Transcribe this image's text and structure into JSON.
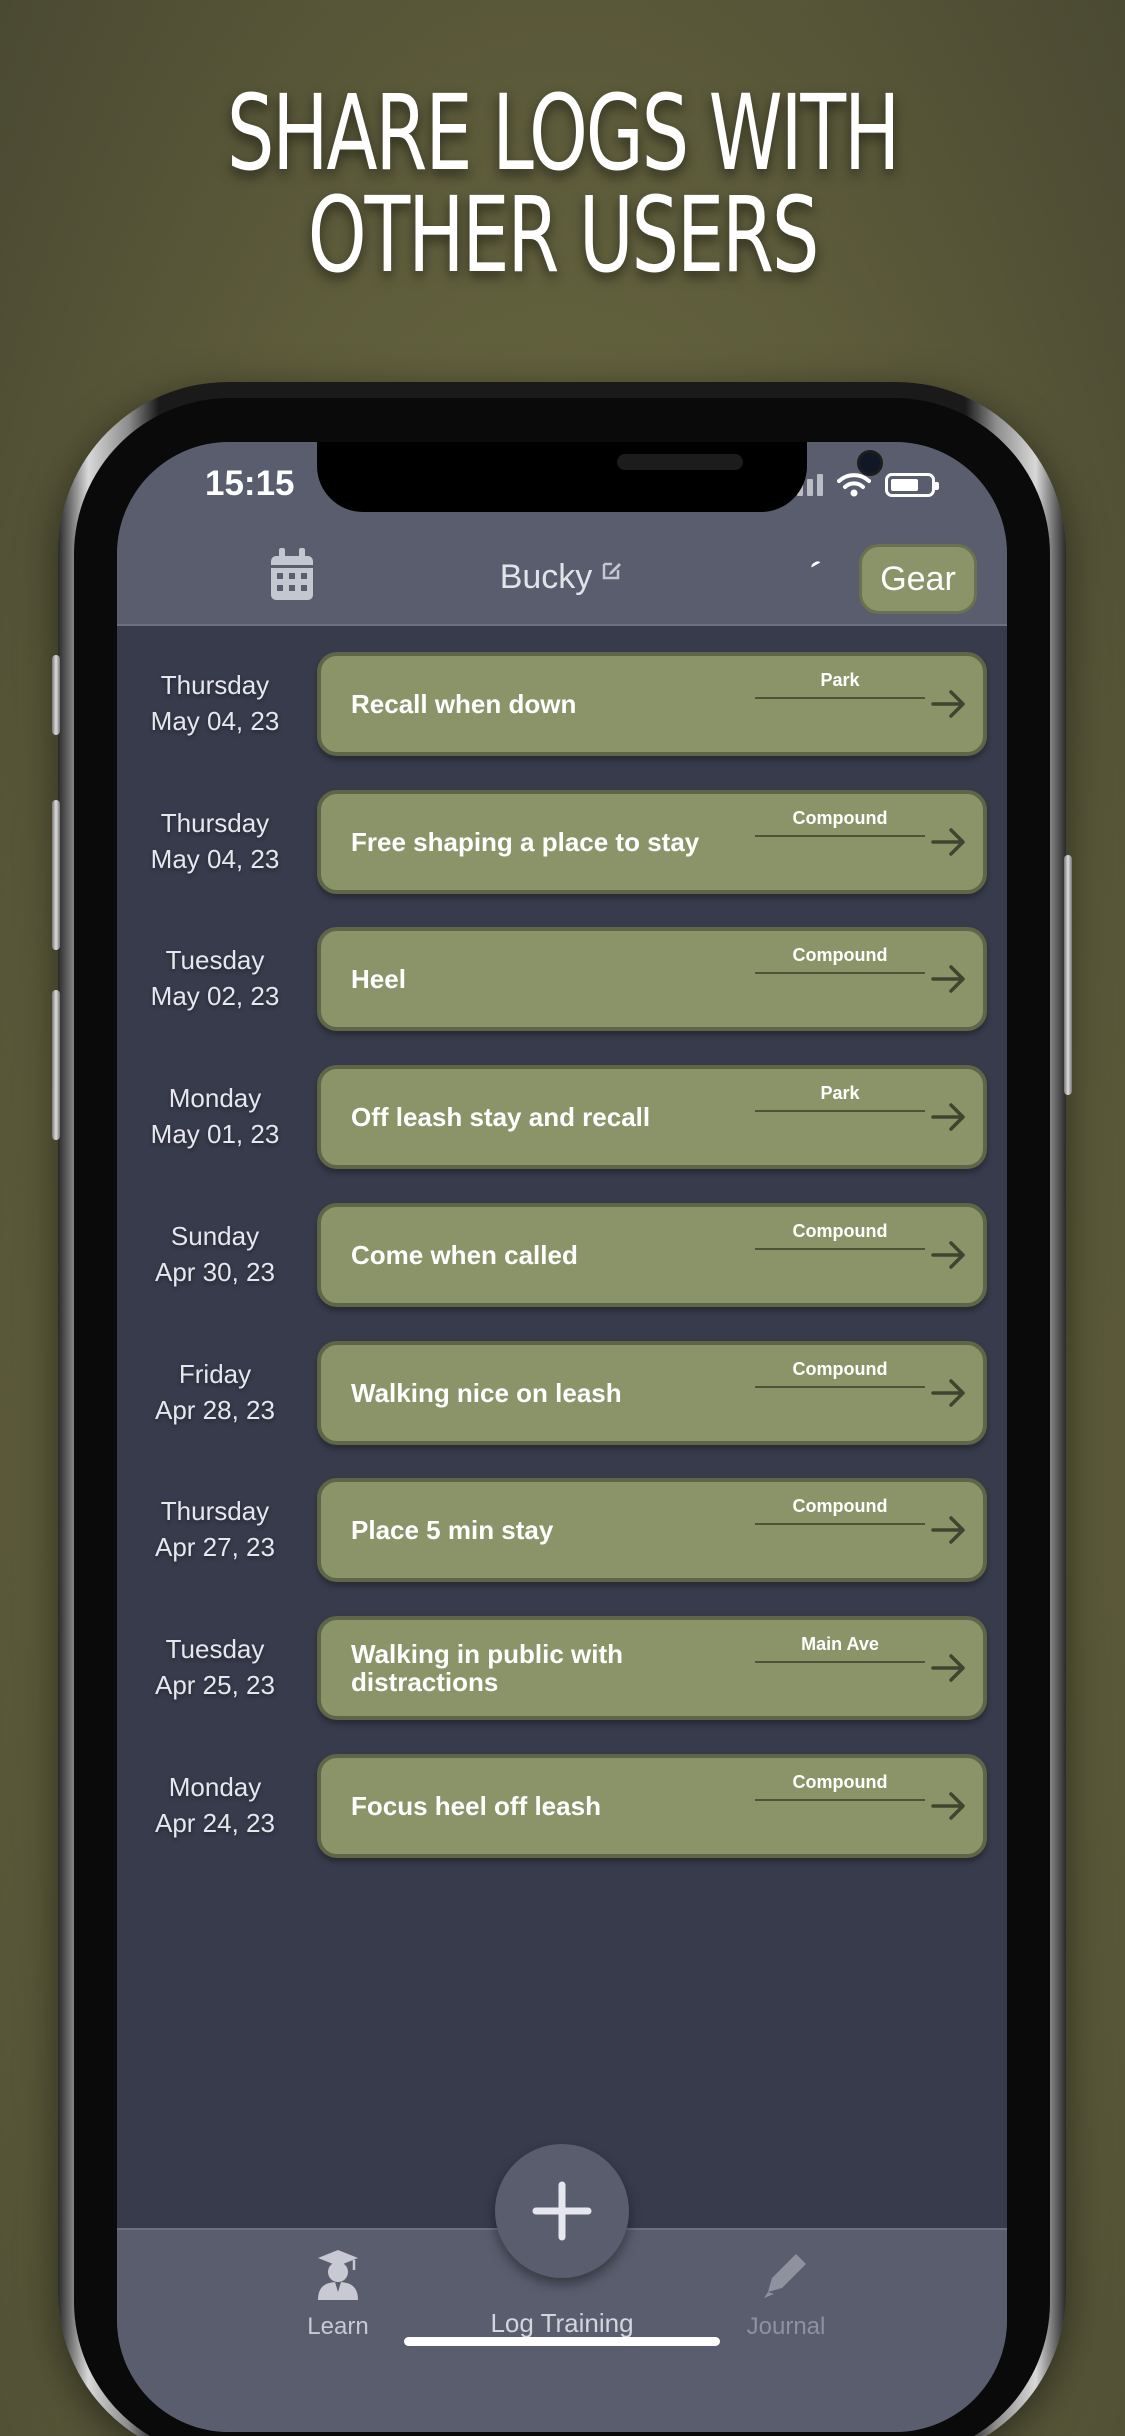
{
  "headline": {
    "line1": "SHARE LOGS WITH",
    "line2": "OTHER USERS"
  },
  "status": {
    "time": "15:15"
  },
  "header": {
    "dog_name": "Bucky",
    "gear_label": "Gear"
  },
  "entries": [
    {
      "day": "Thursday",
      "date": "May 04, 23",
      "title": "Recall when down",
      "location": "Park"
    },
    {
      "day": "Thursday",
      "date": "May 04, 23",
      "title": "Free shaping a place to stay",
      "location": "Compound"
    },
    {
      "day": "Tuesday",
      "date": "May 02, 23",
      "title": "Heel",
      "location": "Compound"
    },
    {
      "day": "Monday",
      "date": "May 01, 23",
      "title": "Off leash stay and recall",
      "location": "Park"
    },
    {
      "day": "Sunday",
      "date": "Apr 30, 23",
      "title": "Come when called",
      "location": "Compound"
    },
    {
      "day": "Friday",
      "date": "Apr 28, 23",
      "title": "Walking nice on leash",
      "location": "Compound"
    },
    {
      "day": "Thursday",
      "date": "Apr 27, 23",
      "title": "Place 5 min stay",
      "location": "Compound"
    },
    {
      "day": "Tuesday",
      "date": "Apr 25, 23",
      "title": "Walking in public with distractions",
      "location": "Main Ave"
    },
    {
      "day": "Monday",
      "date": "Apr 24, 23",
      "title": "Focus heel off leash",
      "location": "Compound"
    }
  ],
  "tabs": {
    "learn": "Learn",
    "log": "Log Training",
    "journal": "Journal"
  },
  "colors": {
    "card": "#8b9468",
    "bar": "#5a5d6e",
    "background": "#383b4c"
  }
}
